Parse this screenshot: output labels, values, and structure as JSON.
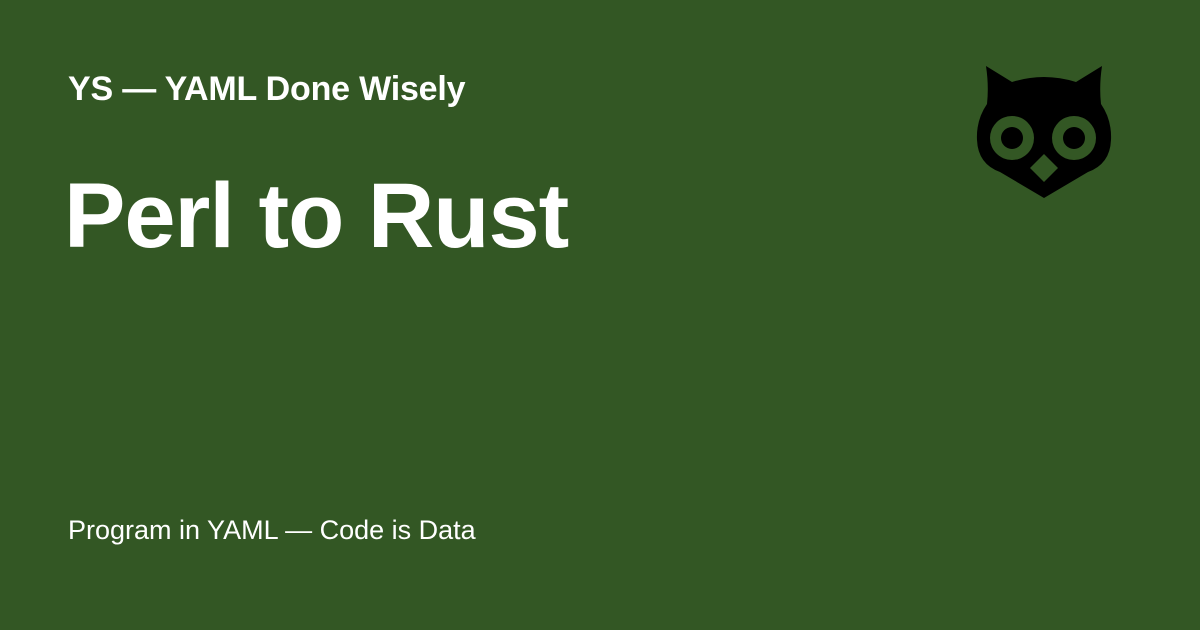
{
  "header": {
    "site_title": "YS — YAML Done Wisely",
    "logo_icon": "owl-icon"
  },
  "main": {
    "page_title": "Perl to Rust"
  },
  "footer": {
    "tagline": "Program in YAML — Code is Data"
  },
  "colors": {
    "background": "#335724",
    "text": "#ffffff",
    "logo": "#000000"
  }
}
